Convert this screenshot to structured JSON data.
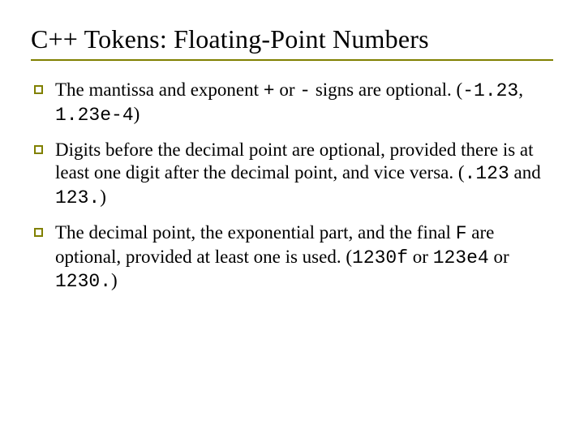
{
  "title": "C++ Tokens: Floating-Point Numbers",
  "bullets": [
    {
      "pre1": "The mantissa and exponent ",
      "code1": "+",
      "mid1": " or ",
      "code2": "-",
      "mid2": " signs are optional. (",
      "code3": "-1.23",
      "mid3": ", ",
      "code4": "1.23e-4",
      "post": ")"
    },
    {
      "pre1": "Digits before the decimal point are optional, provided there is at least one digit after the decimal point, and vice versa. (",
      "code1": ".123",
      "mid1": " and ",
      "code2": "123.",
      "post": ")"
    },
    {
      "pre1": "The decimal point, the exponential part, and the final ",
      "code1": "F",
      "mid1": " are optional, provided at least one is used.  (",
      "code2": "1230f",
      "mid2": " or ",
      "code3": "123e4",
      "mid3": " or ",
      "code4": "1230.",
      "post": ")"
    }
  ]
}
